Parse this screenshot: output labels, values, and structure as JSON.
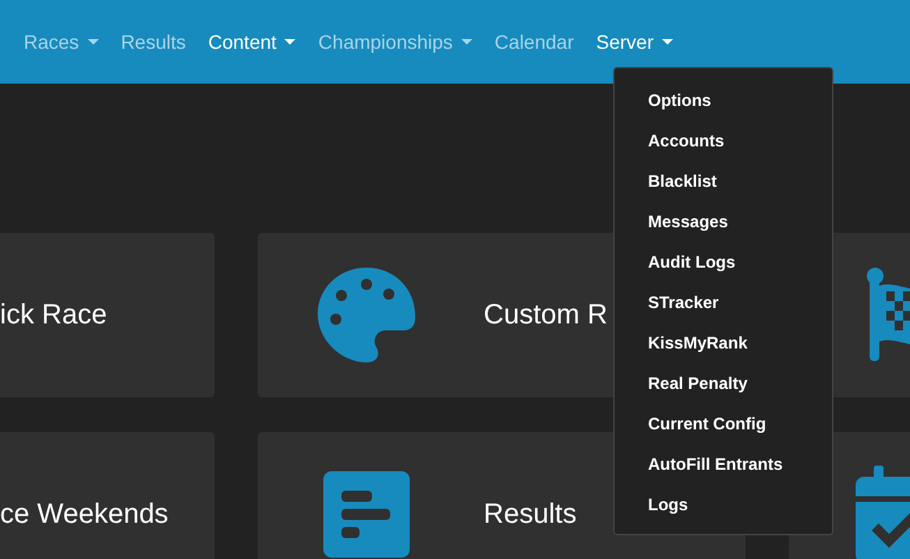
{
  "navbar": {
    "items": [
      {
        "label": "Races",
        "dropdown": true,
        "selected": false
      },
      {
        "label": "Results",
        "dropdown": false,
        "selected": false
      },
      {
        "label": "Content",
        "dropdown": true,
        "selected": true
      },
      {
        "label": "Championships",
        "dropdown": true,
        "selected": false
      },
      {
        "label": "Calendar",
        "dropdown": false,
        "selected": false
      },
      {
        "label": "Server",
        "dropdown": true,
        "selected": true
      }
    ]
  },
  "cards": [
    {
      "text": "ick Race",
      "kind": "none"
    },
    {
      "text": "Custom R",
      "kind": "palette"
    },
    {
      "kind": "flag"
    },
    {
      "text": "ce Weekends",
      "kind": "none"
    },
    {
      "text": "Results",
      "kind": "results"
    },
    {
      "kind": "calendar"
    }
  ],
  "server_menu": {
    "items": [
      "Options",
      "Accounts",
      "Blacklist",
      "Messages",
      "Audit Logs",
      "STracker",
      "KissMyRank",
      "Real Penalty",
      "Current Config",
      "AutoFill Entrants",
      "Logs"
    ]
  }
}
